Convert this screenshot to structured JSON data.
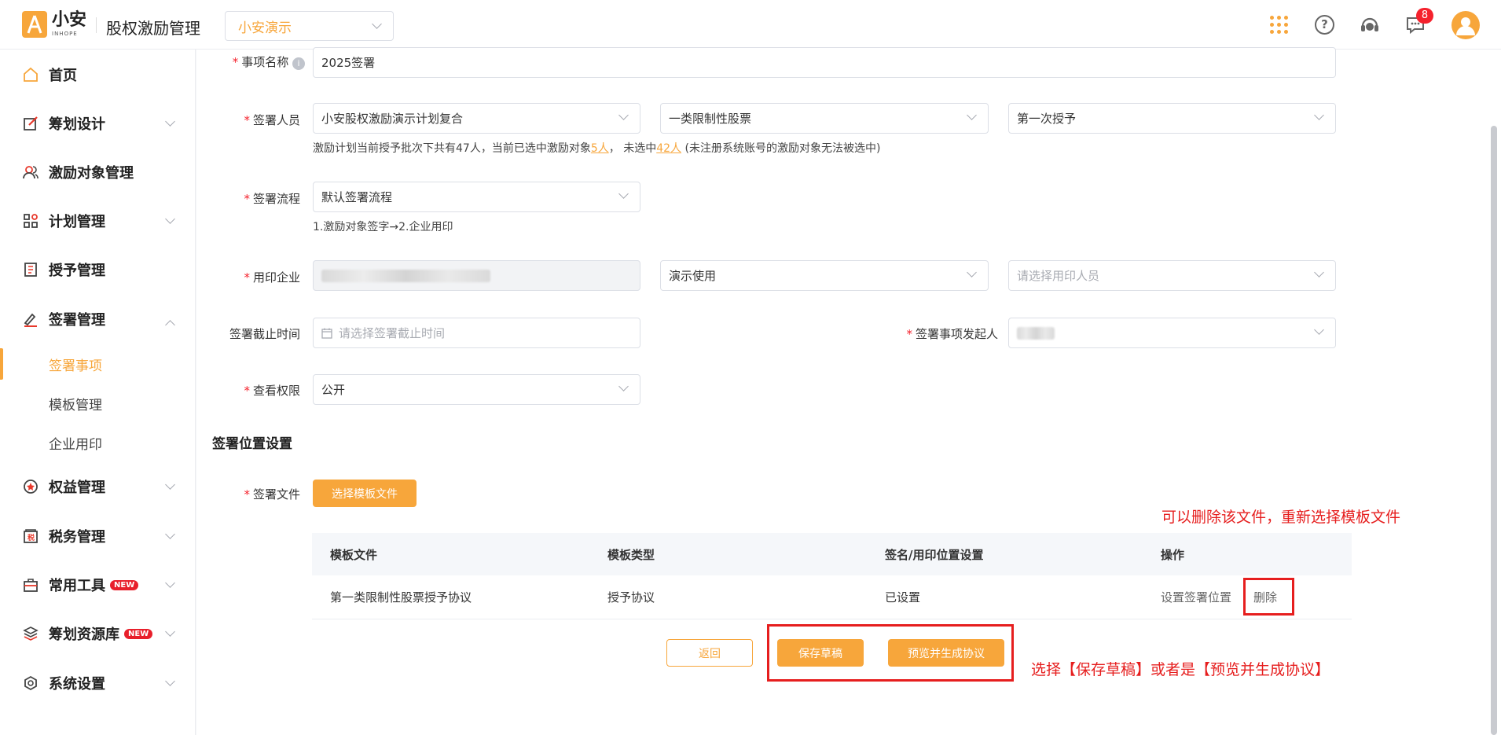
{
  "header": {
    "logo_cn": "小安",
    "logo_en": "INHOPE",
    "app_title": "股权激励管理",
    "company": "小安演示",
    "notification_count": "8"
  },
  "sidebar": {
    "items": [
      {
        "label": "首页",
        "icon": "home-icon"
      },
      {
        "label": "筹划设计",
        "icon": "edit-icon"
      },
      {
        "label": "激励对象管理",
        "icon": "users-icon"
      },
      {
        "label": "计划管理",
        "icon": "apps-icon"
      },
      {
        "label": "授予管理",
        "icon": "book-icon"
      },
      {
        "label": "签署管理",
        "icon": "sign-icon"
      },
      {
        "label": "权益管理",
        "icon": "badge-icon"
      },
      {
        "label": "税务管理",
        "icon": "tax-icon"
      },
      {
        "label": "常用工具",
        "icon": "toolbox-icon"
      },
      {
        "label": "筹划资源库",
        "icon": "layers-icon"
      },
      {
        "label": "系统设置",
        "icon": "settings-icon"
      }
    ],
    "sub_items": [
      "签署事项",
      "模板管理",
      "企业用印"
    ],
    "new_tag": "NEW"
  },
  "form": {
    "name_label": "事项名称",
    "name_value": "2025签署",
    "signer_label": "签署人员",
    "signer_plan": "小安股权激励演示计划复合",
    "signer_type": "一类限制性股票",
    "signer_batch": "第一次授予",
    "hint_prefix": "激励计划当前授予批次下共有47人，当前已选中激励对象",
    "hint_selected": "5人",
    "hint_mid": "， 未选中",
    "hint_unselected": "42人",
    "hint_suffix": "(未注册系统账号的激励对象无法被选中)",
    "flow_label": "签署流程",
    "flow_value": "默认签署流程",
    "flow_hint": "1.激励对象签字→2.企业用印",
    "seal_label": "用印企业",
    "seal_usage": "演示使用",
    "seal_person_placeholder": "请选择用印人员",
    "deadline_label": "签署截止时间",
    "deadline_placeholder": "请选择签署截止时间",
    "initiator_label": "签署事项发起人",
    "view_label": "查看权限",
    "view_value": "公开"
  },
  "position": {
    "section_title": "签署位置设置",
    "file_label": "签署文件",
    "choose_template_btn": "选择模板文件",
    "columns": [
      "模板文件",
      "模板类型",
      "签名/用印位置设置",
      "操作"
    ],
    "rows": [
      {
        "file": "第一类限制性股票授予协议",
        "type": "授予协议",
        "status": "已设置",
        "action_set": "设置签署位置",
        "action_delete": "删除"
      }
    ]
  },
  "footer": {
    "back": "返回",
    "save_draft": "保存草稿",
    "preview": "预览并生成协议"
  },
  "annotations": {
    "delete_note": "可以删除该文件，重新选择模板文件",
    "action_note": "选择【保存草稿】或者是【预览并生成协议】",
    "color": "#e61e1e"
  }
}
